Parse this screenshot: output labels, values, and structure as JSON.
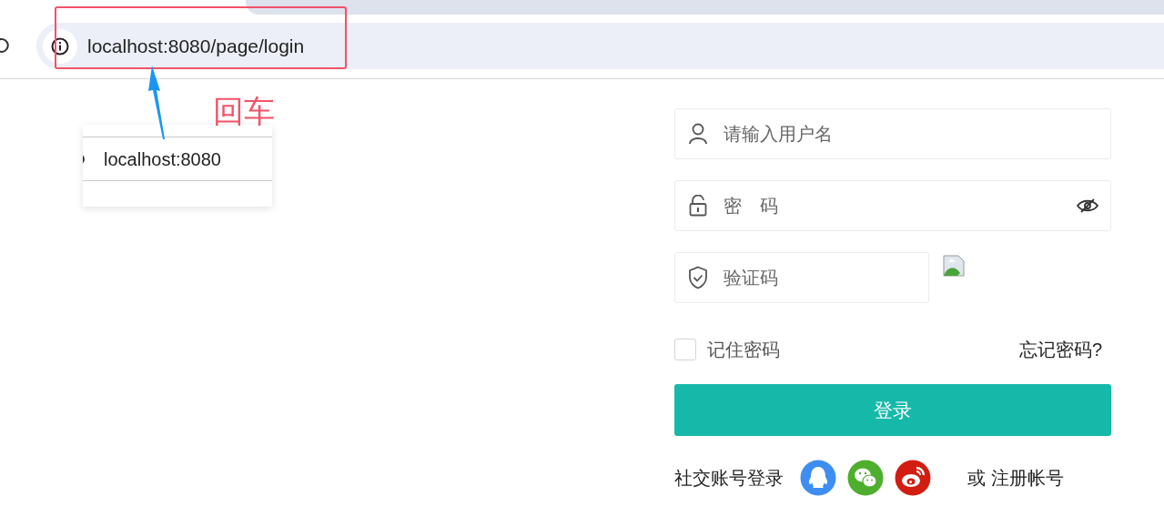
{
  "browser": {
    "url": "localhost:8080/page/login"
  },
  "annotation": {
    "label": "回车"
  },
  "suggestion": {
    "text": "localhost:8080"
  },
  "login": {
    "fields": [
      {
        "kind": "username",
        "placeholder": "请输入用户名"
      },
      {
        "kind": "password",
        "placeholder": "密　码"
      },
      {
        "kind": "captcha",
        "placeholder": "验证码"
      }
    ],
    "remember": {
      "label": "记住密码",
      "checked": false
    },
    "forgot": "忘记密码?",
    "submit": "登录",
    "social_label": "社交账号登录",
    "social": [
      {
        "kind": "qq"
      },
      {
        "kind": "wechat"
      },
      {
        "kind": "weibo"
      }
    ],
    "register": "或 注册帐号"
  }
}
